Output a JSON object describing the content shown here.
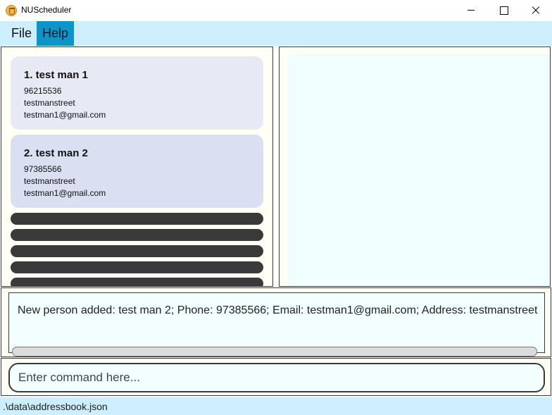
{
  "window": {
    "title": "NUScheduler"
  },
  "menu": {
    "file_label": "File",
    "help_label": "Help"
  },
  "persons": [
    {
      "index_name": "1.  test man 1",
      "phone": "96215536",
      "address": "testmanstreet",
      "email": "testman1@gmail.com"
    },
    {
      "index_name": "2.  test man 2",
      "phone": "97385566",
      "address": "testmanstreet",
      "email": "testman1@gmail.com"
    }
  ],
  "result": {
    "message": "New person added: test man 2; Phone: 97385566; Email: testman1@gmail.com; Address: testmanstreet"
  },
  "command": {
    "placeholder": "Enter command here..."
  },
  "status": {
    "file_path": ".\\data\\addressbook.json"
  }
}
